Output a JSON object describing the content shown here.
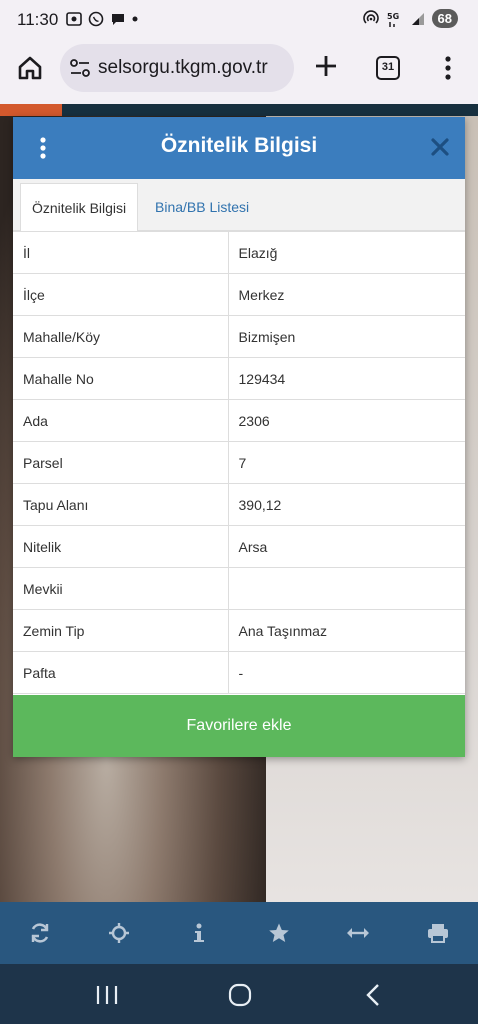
{
  "status_bar": {
    "time": "11:30",
    "battery": "68"
  },
  "browser": {
    "url": "selsorgu.tkgm.gov.tr",
    "tab_count": "31"
  },
  "modal": {
    "title": "Öznitelik Bilgisi",
    "tabs": [
      {
        "label": "Öznitelik Bilgisi",
        "active": true
      },
      {
        "label": "Bina/BB Listesi",
        "active": false
      }
    ],
    "rows": [
      {
        "label": "İl",
        "value": "Elazığ"
      },
      {
        "label": "İlçe",
        "value": "Merkez"
      },
      {
        "label": "Mahalle/Köy",
        "value": "Bizmişen"
      },
      {
        "label": "Mahalle No",
        "value": "129434"
      },
      {
        "label": "Ada",
        "value": "2306"
      },
      {
        "label": "Parsel",
        "value": "7"
      },
      {
        "label": "Tapu Alanı",
        "value": "390,12"
      },
      {
        "label": "Nitelik",
        "value": "Arsa"
      },
      {
        "label": "Mevkii",
        "value": ""
      },
      {
        "label": "Zemin Tip",
        "value": "Ana Taşınmaz"
      },
      {
        "label": "Pafta",
        "value": "-"
      }
    ],
    "favorite_button": "Favorilere ekle"
  },
  "toolbar_icons": [
    "refresh-icon",
    "locate-icon",
    "info-icon",
    "star-icon",
    "measure-icon",
    "print-icon"
  ],
  "colors": {
    "header": "#3b7dbe",
    "favorite": "#5cb85c",
    "toolbar": "#29577f",
    "nav": "#1e344a",
    "tab_link": "#3173ae"
  }
}
